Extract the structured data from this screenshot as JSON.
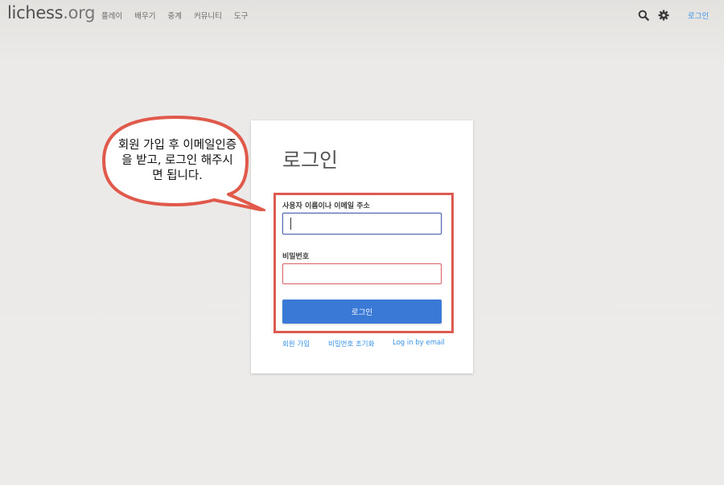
{
  "header": {
    "logo": "lichess",
    "logo_tld": ".org",
    "nav": [
      "플레이",
      "배우기",
      "중계",
      "커뮤니티",
      "도구"
    ],
    "search_icon": "search-icon",
    "settings_icon": "gear-icon",
    "signin": "로그인"
  },
  "login": {
    "title": "로그인",
    "username_label": "사용자 이름이나 이메일 주소",
    "username_value": "",
    "password_label": "비밀번호",
    "password_value": "",
    "submit": "로그인",
    "links": {
      "signup": "회원 가입",
      "reset": "비밀번호 초기화",
      "email_login": "Log in by email"
    }
  },
  "annotation": {
    "lines": [
      "회원 가입 후 이메일인증",
      "을 받고, 로그인 해주시",
      "면 됩니다."
    ]
  },
  "colors": {
    "accent": "#3692e7",
    "button": "#3a7ad6",
    "highlight": "#dd5a50"
  }
}
